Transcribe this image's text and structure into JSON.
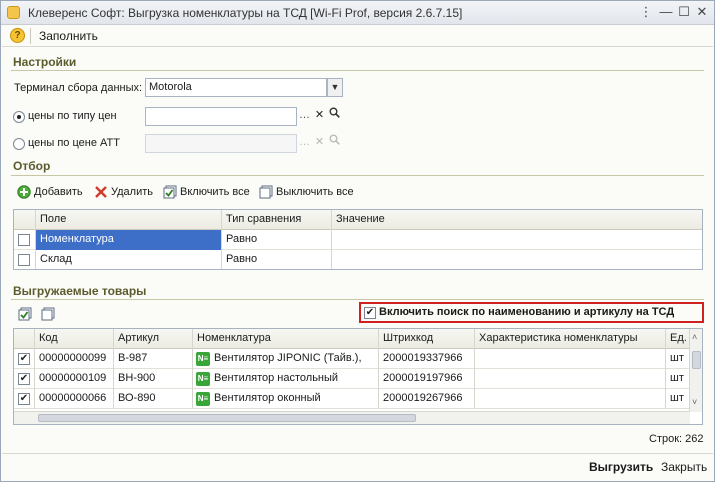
{
  "window": {
    "title": "Клеверенс Софт: Выгрузка номенклатуры на ТСД [Wi-Fi Prof, версия 2.6.7.15]",
    "controls": {
      "menu": "⋮",
      "minimize": "—",
      "maximize": "☐",
      "close": "✕"
    }
  },
  "toolbar": {
    "fill_label": "Заполнить",
    "help_icon": "?"
  },
  "settings": {
    "section_title": "Настройки",
    "terminal_label": "Терминал сбора данных:",
    "terminal_value": "Motorola",
    "price_type_label": "цены по типу цен",
    "price_type_value": "",
    "price_att_label": "цены по цене АТТ",
    "price_att_value": "",
    "selected_price_mode": "type"
  },
  "filter": {
    "section_title": "Отбор",
    "toolbar": {
      "add": "Добавить",
      "delete": "Удалить",
      "enable_all": "Включить все",
      "disable_all": "Выключить все"
    },
    "columns": {
      "field": "Поле",
      "comparison": "Тип сравнения",
      "value": "Значение"
    },
    "rows": [
      {
        "checked": false,
        "field": "Номенклатура",
        "comparison": "Равно",
        "value": "",
        "selected": true
      },
      {
        "checked": false,
        "field": "Склад",
        "comparison": "Равно",
        "value": "",
        "selected": false
      }
    ]
  },
  "goods": {
    "section_title": "Выгружаемые товары",
    "search_checkbox_label": "Включить поиск по наименованию и артикулу на ТСД",
    "search_checkbox_checked": true,
    "columns": {
      "code": "Код",
      "article": "Артикул",
      "nomenclature": "Номенклатура",
      "barcode": "Штрихкод",
      "characteristic": "Характеристика номенклатуры",
      "unit": "Ед."
    },
    "rows": [
      {
        "checked": true,
        "code": "00000000099",
        "article": "В-987",
        "nomenclature": "Вентилятор JIPONIC (Тайв.),",
        "barcode": "2000019337966",
        "characteristic": "",
        "unit": "шт"
      },
      {
        "checked": true,
        "code": "00000000109",
        "article": "ВН-900",
        "nomenclature": "Вентилятор настольный",
        "barcode": "2000019197966",
        "characteristic": "",
        "unit": "шт"
      },
      {
        "checked": true,
        "code": "00000000066",
        "article": "ВО-890",
        "nomenclature": "Вентилятор оконный",
        "barcode": "2000019267966",
        "characteristic": "",
        "unit": "шт"
      }
    ],
    "nom_icon_text": "N≡",
    "rows_count_label": "Строк: 262"
  },
  "footer": {
    "export_label": "Выгрузить",
    "close_label": "Закрыть"
  }
}
